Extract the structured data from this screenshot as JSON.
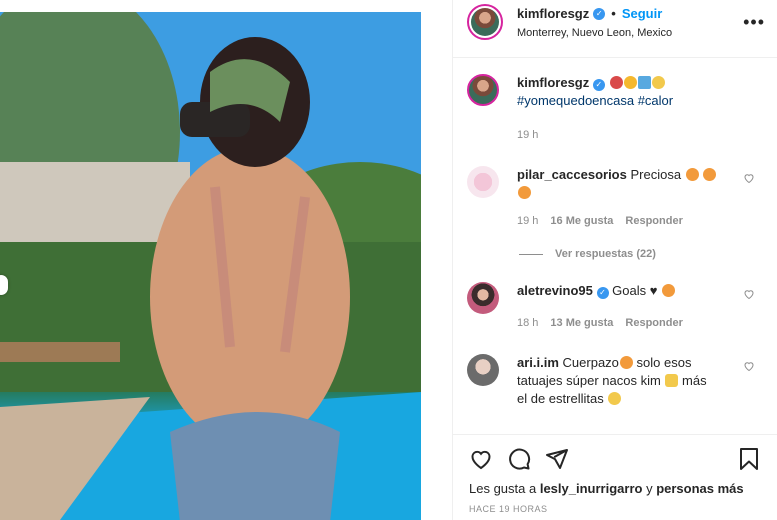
{
  "post": {
    "username": "kimfloresgz",
    "follow_label": "Seguir",
    "location": "Monterrey, Nuevo Leon, Mexico"
  },
  "caption": {
    "username": "kimfloresgz",
    "hashtags": "#yomequedoencasa #calor",
    "time": "19 h"
  },
  "comments": [
    {
      "username": "pilar_caccesorios",
      "text": "Preciosa",
      "time": "19 h",
      "likes": "16 Me gusta",
      "reply": "Responder",
      "view_replies": "Ver respuestas (22)"
    },
    {
      "username": "aletrevino95",
      "text": "Goals ♥",
      "time": "18 h",
      "likes": "13 Me gusta",
      "reply": "Responder"
    },
    {
      "username": "ari.i.im",
      "text": "Cuerpazo",
      "text2": "solo esos tatuajes súper nacos kim",
      "text3": "más el de estrellitas"
    }
  ],
  "likes": {
    "prefix": "Les gusta a",
    "user": "lesly_inurrigarro",
    "conj": "y",
    "others": "personas más"
  },
  "ago": "HACE 19 HORAS",
  "colors": {
    "accent": "#0095f6",
    "verified": "#3897f0",
    "muted": "#8e8e8e"
  },
  "icons": [
    "heart-icon",
    "comment-icon",
    "share-icon",
    "bookmark-icon",
    "more-icon",
    "verified-icon"
  ]
}
